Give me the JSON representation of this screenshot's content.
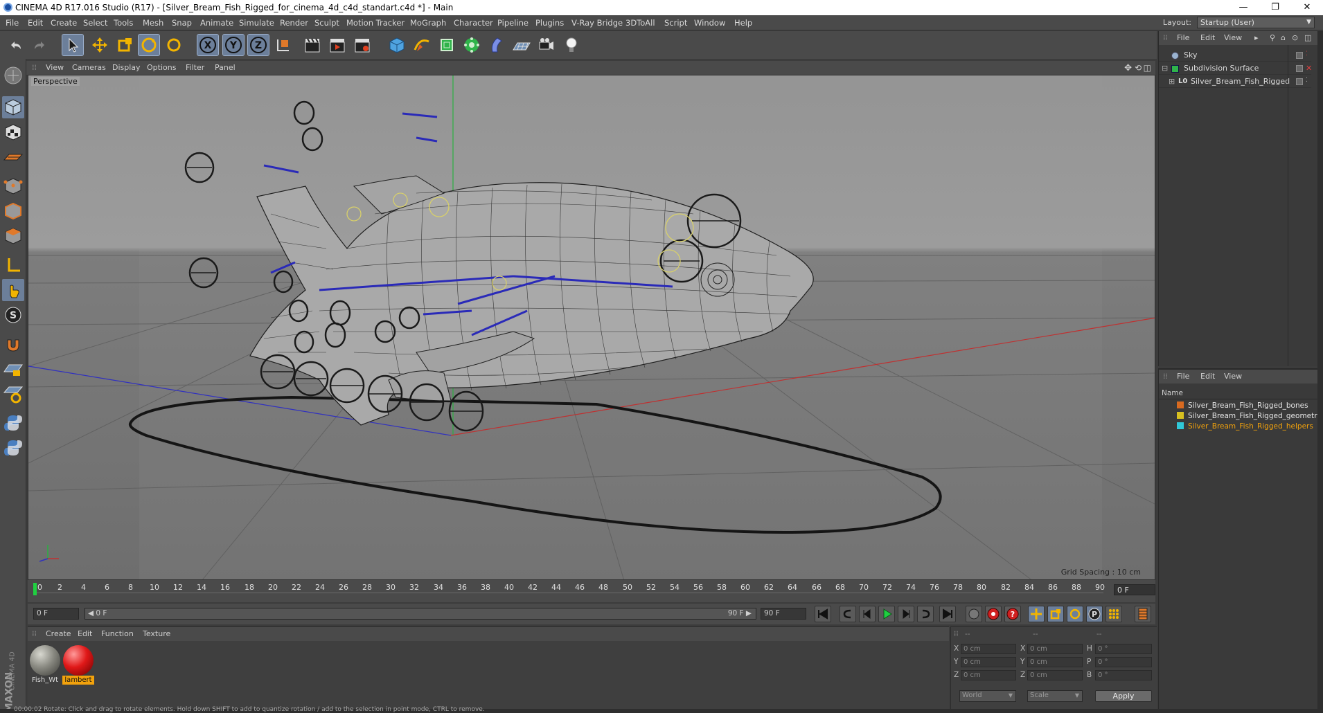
{
  "window": {
    "title": "CINEMA 4D R17.016 Studio (R17) - [Silver_Bream_Fish_Rigged_for_cinema_4d_c4d_standart.c4d *] - Main",
    "controls": [
      "—",
      "❐",
      "✕"
    ]
  },
  "menu": [
    "File",
    "Edit",
    "Create",
    "Select",
    "Tools",
    "Mesh",
    "Snap",
    "Animate",
    "Simulate",
    "Render",
    "Sculpt",
    "Motion Tracker",
    "MoGraph",
    "Character",
    "Pipeline",
    "Plugins",
    "V-Ray Bridge",
    "3DToAll",
    "Script",
    "Window",
    "Help"
  ],
  "layout": {
    "label": "Layout:",
    "value": "Startup (User)"
  },
  "viewport": {
    "menu": [
      "View",
      "Cameras",
      "Display",
      "Options",
      "Filter",
      "Panel"
    ],
    "label": "Perspective",
    "grid_spacing": "Grid Spacing : 10 cm"
  },
  "timeline": {
    "ticks": [
      "0",
      "2",
      "4",
      "6",
      "8",
      "10",
      "12",
      "14",
      "16",
      "18",
      "20",
      "22",
      "24",
      "26",
      "28",
      "30",
      "32",
      "34",
      "36",
      "38",
      "40",
      "42",
      "44",
      "46",
      "48",
      "50",
      "52",
      "54",
      "56",
      "58",
      "60",
      "62",
      "64",
      "66",
      "68",
      "70",
      "72",
      "74",
      "76",
      "78",
      "80",
      "82",
      "84",
      "86",
      "88",
      "90"
    ],
    "current_frame": "0 F"
  },
  "transport": {
    "start": "0 F",
    "range_start": "◀ 0 F",
    "range_end": "90 F ▶",
    "end": "90 F"
  },
  "materials": {
    "menu": [
      "Create",
      "Edit",
      "Function",
      "Texture"
    ],
    "items": [
      {
        "label": "Fish_Wt",
        "selected": false
      },
      {
        "label": "lambert",
        "selected": true
      }
    ]
  },
  "coordinates": {
    "header": [
      "--",
      "--",
      "--"
    ],
    "rows": [
      {
        "l1": "X",
        "v1": "0 cm",
        "l2": "X",
        "v2": "0 cm",
        "l3": "H",
        "v3": "0 °"
      },
      {
        "l1": "Y",
        "v1": "0 cm",
        "l2": "Y",
        "v2": "0 cm",
        "l3": "P",
        "v3": "0 °"
      },
      {
        "l1": "Z",
        "v1": "0 cm",
        "l2": "Z",
        "v2": "0 cm",
        "l3": "B",
        "v3": "0 °"
      }
    ],
    "space": "World",
    "mode": "Scale",
    "apply": "Apply"
  },
  "objects": {
    "menu": [
      "File",
      "Edit",
      "View"
    ],
    "items": [
      {
        "name": "Sky"
      },
      {
        "name": "Subdivision Surface"
      },
      {
        "name": "Silver_Bream_Fish_Rigged"
      }
    ]
  },
  "layers": {
    "menu": [
      "File",
      "Edit",
      "View"
    ],
    "header": "Name",
    "items": [
      {
        "name": "Silver_Bream_Fish_Rigged_bones",
        "color": "#d86a20"
      },
      {
        "name": "Silver_Bream_Fish_Rigged_geometry",
        "color": "#d8c020"
      },
      {
        "name": "Silver_Bream_Fish_Rigged_helpers",
        "color": "#30c8d8"
      }
    ]
  },
  "logo": {
    "text1": "MAXON",
    "text2": "CINEMA 4D"
  },
  "status": "00:00:02  Rotate: Click and drag to rotate elements. Hold down SHIFT to add to quantize rotation / add to the selection in point mode, CTRL to remove."
}
